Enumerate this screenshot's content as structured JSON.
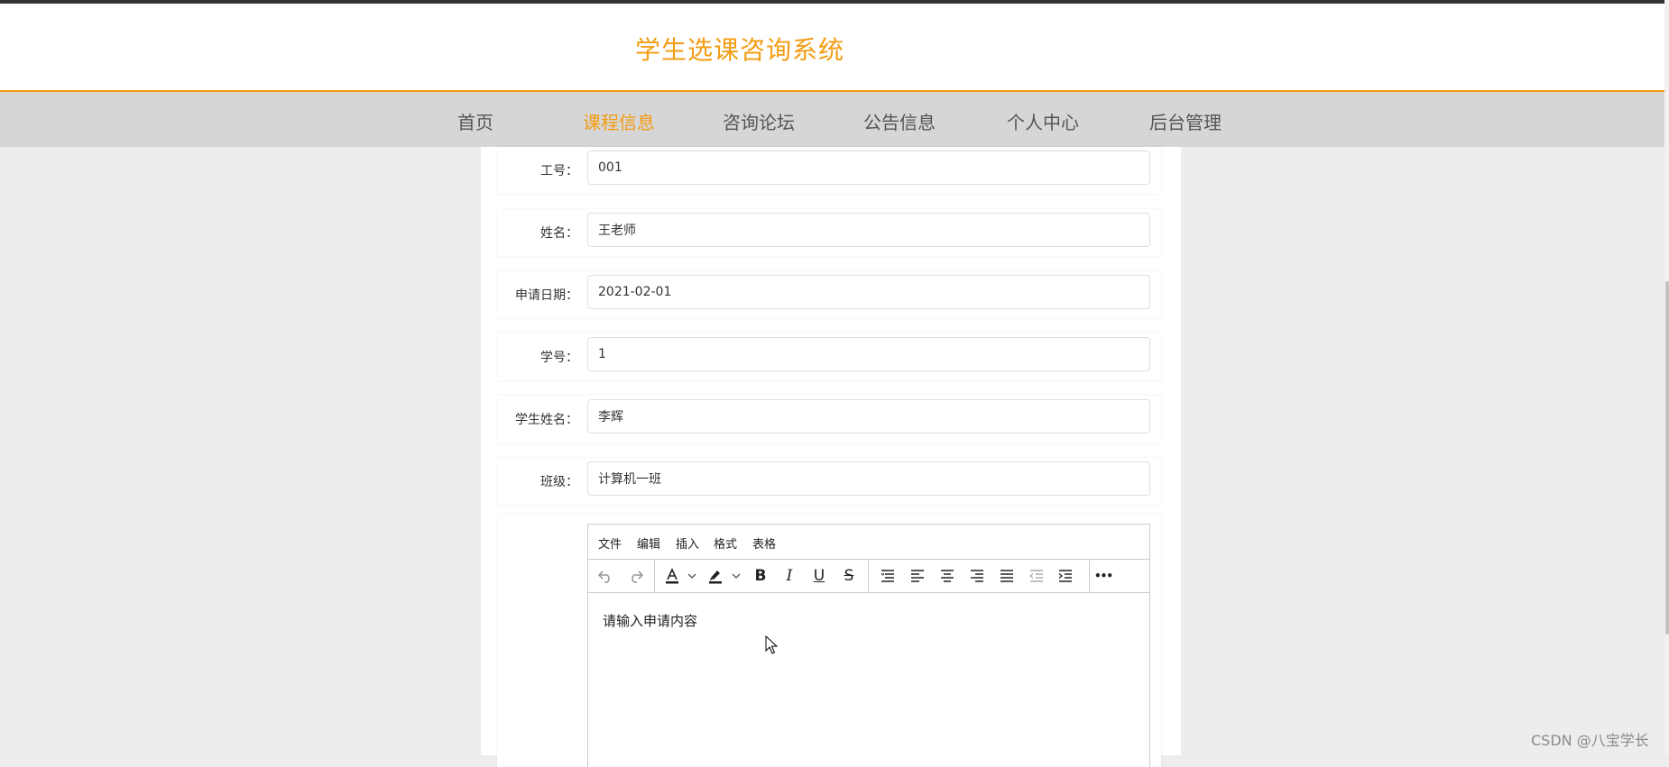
{
  "header": {
    "site_title": "学生选课咨询系统"
  },
  "nav": {
    "items": [
      {
        "label": "首页"
      },
      {
        "label": "课程信息",
        "active": true
      },
      {
        "label": "咨询论坛"
      },
      {
        "label": "公告信息"
      },
      {
        "label": "个人中心"
      },
      {
        "label": "后台管理"
      }
    ]
  },
  "form": {
    "fields": [
      {
        "label": "工号：",
        "value": "001"
      },
      {
        "label": "姓名：",
        "value": "王老师"
      },
      {
        "label": "申请日期：",
        "value": "2021-02-01"
      },
      {
        "label": "学号：",
        "value": "1"
      },
      {
        "label": "学生姓名：",
        "value": "李辉"
      },
      {
        "label": "班级：",
        "value": "计算机一班"
      }
    ]
  },
  "editor": {
    "menus": [
      "文件",
      "编辑",
      "插入",
      "格式",
      "表格"
    ],
    "toolbar_icons": [
      "undo-icon",
      "redo-icon",
      "text-color-icon",
      "highlight-color-icon",
      "bold-icon",
      "italic-icon",
      "underline-icon",
      "strikethrough-icon",
      "line-height-icon",
      "align-left-icon",
      "align-center-icon",
      "align-right-icon",
      "align-justify-icon",
      "outdent-icon",
      "indent-icon",
      "more-icon"
    ],
    "bold_glyph": "B",
    "italic_glyph": "I",
    "underline_glyph": "U",
    "strike_glyph": "S",
    "more_glyph": "•••",
    "placeholder": "请输入申请内容"
  },
  "watermark": "CSDN @八宝学长",
  "colors": {
    "accent": "#f39c12",
    "nav_bg": "#d6d6d6",
    "page_bg": "#ededed"
  }
}
